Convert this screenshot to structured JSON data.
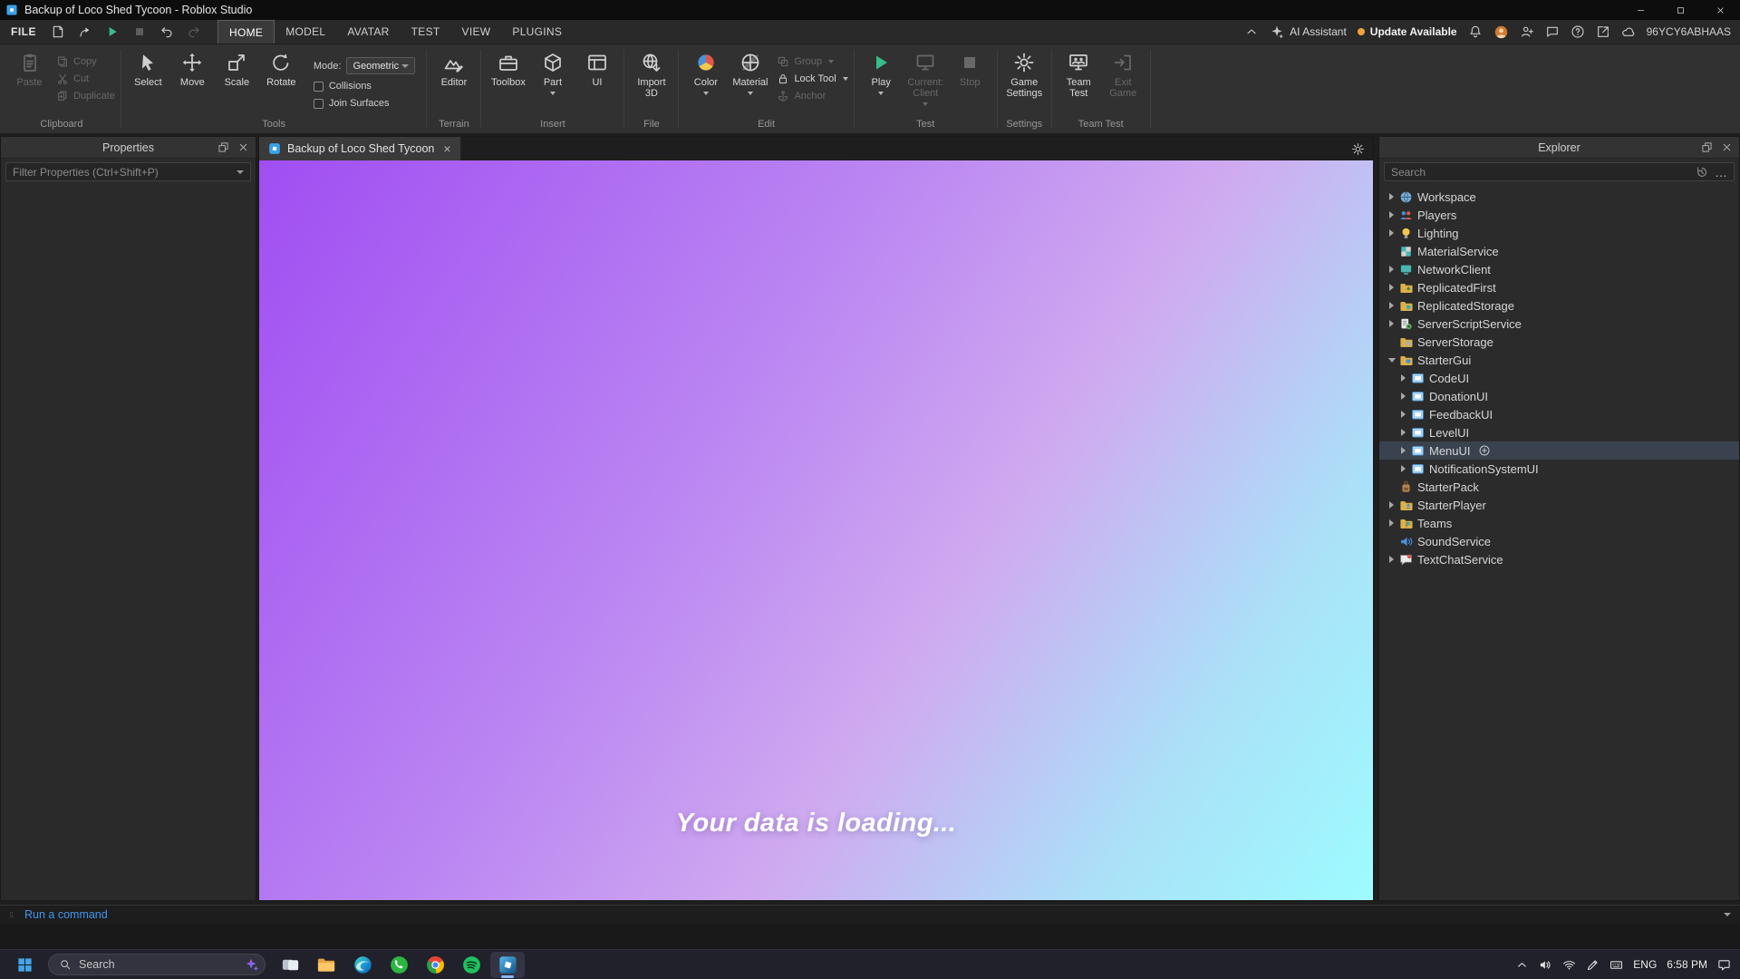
{
  "window": {
    "title": "Backup of Loco Shed Tycoon - Roblox Studio"
  },
  "menu_bar": {
    "file_label": "FILE",
    "quick_actions": [
      {
        "name": "save",
        "icon": "save",
        "state": "normal"
      },
      {
        "name": "publish",
        "icon": "publish",
        "state": "normal"
      },
      {
        "name": "play",
        "icon": "play",
        "state": "accent"
      },
      {
        "name": "stop",
        "icon": "stop",
        "state": "disabled"
      },
      {
        "name": "undo",
        "icon": "undo",
        "state": "normal"
      },
      {
        "name": "redo",
        "icon": "redo",
        "state": "disabled"
      }
    ],
    "tabs": [
      {
        "label": "HOME",
        "active": true
      },
      {
        "label": "MODEL",
        "active": false
      },
      {
        "label": "AVATAR",
        "active": false
      },
      {
        "label": "TEST",
        "active": false
      },
      {
        "label": "VIEW",
        "active": false
      },
      {
        "label": "PLUGINS",
        "active": false
      }
    ],
    "right": {
      "ai_assistant": "AI Assistant",
      "update_available": "Update Available",
      "username": "96YCY6ABHAAS",
      "icons": [
        {
          "name": "notifications",
          "icon": "bell"
        },
        {
          "name": "account-avatar",
          "icon": "avatar"
        },
        {
          "name": "collaborate",
          "icon": "addperson"
        },
        {
          "name": "comments",
          "icon": "chat"
        },
        {
          "name": "help",
          "icon": "help"
        },
        {
          "name": "share",
          "icon": "share"
        },
        {
          "name": "cloud-sync",
          "icon": "cloud"
        }
      ]
    }
  },
  "ribbon": {
    "groups": [
      {
        "label": "Clipboard",
        "items": [
          {
            "type": "big",
            "label": "Paste",
            "icon": "paste",
            "disabled": true
          },
          {
            "type": "smallcol",
            "buttons": [
              {
                "label": "Copy",
                "icon": "copy",
                "disabled": true
              },
              {
                "label": "Cut",
                "icon": "cut",
                "disabled": true
              },
              {
                "label": "Duplicate",
                "icon": "duplicate",
                "disabled": true
              }
            ]
          }
        ]
      },
      {
        "label": "Tools",
        "items": [
          {
            "type": "big",
            "label": "Select",
            "icon": "select"
          },
          {
            "type": "big",
            "label": "Move",
            "icon": "move"
          },
          {
            "type": "big",
            "label": "Scale",
            "icon": "scale"
          },
          {
            "type": "big",
            "label": "Rotate",
            "icon": "rotate"
          },
          {
            "type": "toolopts",
            "mode_label": "Mode:",
            "mode_value": "Geometric",
            "checkboxes": [
              {
                "label": "Collisions",
                "checked": false
              },
              {
                "label": "Join Surfaces",
                "checked": false
              }
            ]
          }
        ]
      },
      {
        "label": "Terrain",
        "items": [
          {
            "type": "big",
            "label": "Editor",
            "icon": "terrain"
          }
        ]
      },
      {
        "label": "Insert",
        "items": [
          {
            "type": "big",
            "label": "Toolbox",
            "icon": "toolbox"
          },
          {
            "type": "big",
            "label": "Part",
            "icon": "part",
            "dropdown": true
          },
          {
            "type": "big",
            "label": "UI",
            "icon": "ui"
          }
        ]
      },
      {
        "label": "File",
        "items": [
          {
            "type": "big",
            "label": "Import 3D",
            "icon": "import3d"
          }
        ]
      },
      {
        "label": "Edit",
        "items": [
          {
            "type": "big",
            "label": "Color",
            "icon": "color",
            "dropdown": true
          },
          {
            "type": "big",
            "label": "Material",
            "icon": "material",
            "dropdown": true
          },
          {
            "type": "smallcol",
            "buttons": [
              {
                "label": "Group",
                "icon": "group",
                "disabled": true,
                "dropdown": true
              },
              {
                "label": "Lock Tool",
                "icon": "lock",
                "dropdown": true
              },
              {
                "label": "Anchor",
                "icon": "anchor",
                "disabled": true
              }
            ]
          }
        ]
      },
      {
        "label": "Test",
        "items": [
          {
            "type": "big",
            "label": "Play",
            "icon": "play",
            "accent": true,
            "dropdown": true
          },
          {
            "type": "big",
            "label": "Current: Client",
            "icon": "client",
            "disabled": true,
            "dropdown": true
          },
          {
            "type": "big",
            "label": "Stop",
            "icon": "stop",
            "disabled": true
          }
        ]
      },
      {
        "label": "Settings",
        "items": [
          {
            "type": "big",
            "label": "Game Settings",
            "icon": "gear"
          }
        ]
      },
      {
        "label": "Team Test",
        "items": [
          {
            "type": "big",
            "label": "Team Test",
            "icon": "teamtest"
          },
          {
            "type": "big",
            "label": "Exit Game",
            "icon": "exitgame",
            "disabled": true
          }
        ]
      }
    ]
  },
  "properties_panel": {
    "title": "Properties",
    "filter_placeholder": "Filter Properties (Ctrl+Shift+P)"
  },
  "viewport": {
    "tab_label": "Backup of Loco Shed Tycoon",
    "loading_text": "Your data is loading..."
  },
  "explorer": {
    "title": "Explorer",
    "search_placeholder": "Search",
    "items": [
      {
        "label": "Workspace",
        "icon": "workspace",
        "depth": 0,
        "arrow": "collapsed"
      },
      {
        "label": "Players",
        "icon": "players",
        "depth": 0,
        "arrow": "collapsed"
      },
      {
        "label": "Lighting",
        "icon": "lighting",
        "depth": 0,
        "arrow": "collapsed"
      },
      {
        "label": "MaterialService",
        "icon": "materialservice",
        "depth": 0,
        "arrow": null
      },
      {
        "label": "NetworkClient",
        "icon": "networkclient",
        "depth": 0,
        "arrow": "collapsed"
      },
      {
        "label": "ReplicatedFirst",
        "icon": "folderarrow",
        "depth": 0,
        "arrow": "collapsed"
      },
      {
        "label": "ReplicatedStorage",
        "icon": "folderbox",
        "depth": 0,
        "arrow": "collapsed"
      },
      {
        "label": "ServerScriptService",
        "icon": "serverscript",
        "depth": 0,
        "arrow": "collapsed"
      },
      {
        "label": "ServerStorage",
        "icon": "foldercyl",
        "depth": 0,
        "arrow": null
      },
      {
        "label": "StarterGui",
        "icon": "folderscreen",
        "depth": 0,
        "arrow": "expanded"
      },
      {
        "label": "CodeUI",
        "icon": "screengui",
        "depth": 1,
        "arrow": "collapsed"
      },
      {
        "label": "DonationUI",
        "icon": "screengui",
        "depth": 1,
        "arrow": "collapsed"
      },
      {
        "label": "FeedbackUI",
        "icon": "screengui",
        "depth": 1,
        "arrow": "collapsed"
      },
      {
        "label": "LevelUI",
        "icon": "screengui",
        "depth": 1,
        "arrow": "collapsed"
      },
      {
        "label": "MenuUI",
        "icon": "screengui",
        "depth": 1,
        "arrow": "collapsed",
        "selected": true,
        "add_button": true
      },
      {
        "label": "NotificationSystemUI",
        "icon": "screengui",
        "depth": 1,
        "arrow": "collapsed"
      },
      {
        "label": "StarterPack",
        "icon": "starterpack",
        "depth": 0,
        "arrow": null
      },
      {
        "label": "StarterPlayer",
        "icon": "folderperson",
        "depth": 0,
        "arrow": "collapsed"
      },
      {
        "label": "Teams",
        "icon": "folderflag",
        "depth": 0,
        "arrow": "collapsed"
      },
      {
        "label": "SoundService",
        "icon": "sound",
        "depth": 0,
        "arrow": null
      },
      {
        "label": "TextChatService",
        "icon": "textchat",
        "depth": 0,
        "arrow": "collapsed"
      }
    ]
  },
  "command_bar": {
    "placeholder": "Run a command"
  },
  "taskbar": {
    "search_placeholder": "Search",
    "apps": [
      {
        "name": "task-view",
        "icon": "taskview",
        "active": false
      },
      {
        "name": "file-explorer",
        "icon": "folderwin",
        "active": false
      },
      {
        "name": "edge",
        "icon": "edge",
        "active": false
      },
      {
        "name": "whatsapp",
        "icon": "whatsapp",
        "active": false
      },
      {
        "name": "chrome",
        "icon": "chrome",
        "active": false
      },
      {
        "name": "spotify",
        "icon": "spotify",
        "active": false
      },
      {
        "name": "roblox-studio",
        "icon": "robloxstudio",
        "active": true
      }
    ],
    "tray": {
      "icons": [
        {
          "name": "hidden-icons-chevron",
          "icon": "chevup"
        },
        {
          "name": "volume",
          "icon": "volume"
        },
        {
          "name": "network",
          "icon": "wifi"
        },
        {
          "name": "pen",
          "icon": "pen"
        },
        {
          "name": "touch-keyboard",
          "icon": "keyboard"
        }
      ],
      "language": "ENG",
      "time": "6:58 PM",
      "notification_icon": "notif"
    }
  },
  "glyphs": {
    "close_tab": "×",
    "more": "…"
  },
  "colors": {
    "viewport_gradient": [
      "#a04ef2",
      "#bb86f2",
      "#cfabf0",
      "#abe0f8",
      "#9dfcff"
    ],
    "play_accent": "#36bd8a",
    "update_dot": "#eda33c",
    "command_bar_text": "#4196ef",
    "selection_background": "#39424e"
  }
}
